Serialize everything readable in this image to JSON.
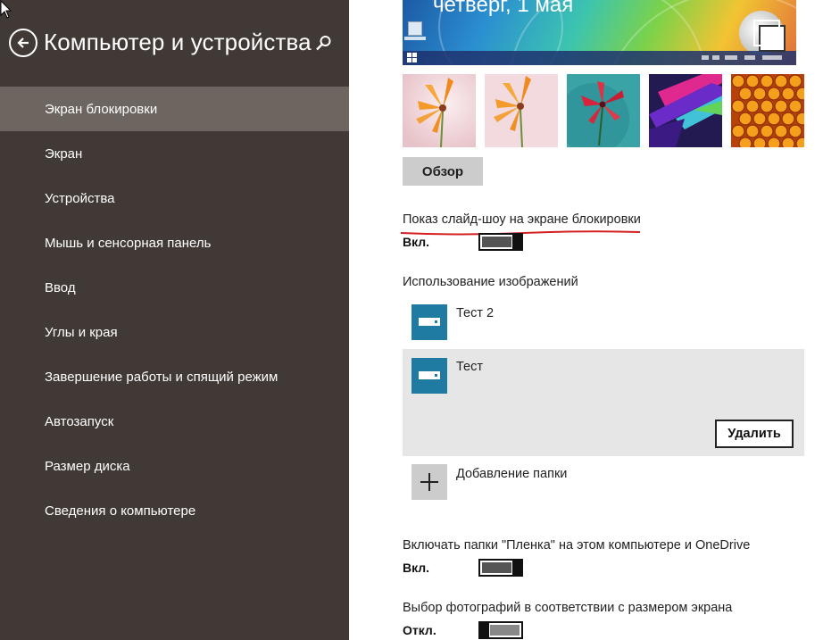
{
  "header": {
    "title": "Компьютер и устройства",
    "back_icon": "back-arrow-circle-icon",
    "search_icon": "search-icon"
  },
  "sidebar": {
    "items": [
      {
        "label": "Экран блокировки",
        "selected": true
      },
      {
        "label": "Экран"
      },
      {
        "label": "Устройства"
      },
      {
        "label": "Мышь и сенсорная панель"
      },
      {
        "label": "Ввод"
      },
      {
        "label": "Углы и края"
      },
      {
        "label": "Завершение работы и спящий режим"
      },
      {
        "label": "Автозапуск"
      },
      {
        "label": "Размер диска"
      },
      {
        "label": "Сведения о компьютере"
      }
    ]
  },
  "preview": {
    "date_text": "четверг, 1 мая"
  },
  "thumbnails": [
    "flower-pink",
    "flower-pink-2",
    "flower-red-teal",
    "geometric-ribbons",
    "honeycomb"
  ],
  "browse_label": "Обзор",
  "slideshow": {
    "label": "Показ слайд-шоу на экране блокировки",
    "state": "Вкл.",
    "on": true
  },
  "images_section": {
    "label": "Использование изображений",
    "folders": [
      {
        "name": "Тест 2",
        "selected": false
      },
      {
        "name": "Тест",
        "selected": true
      }
    ],
    "delete_label": "Удалить",
    "add_folder_label": "Добавление папки"
  },
  "camera_roll": {
    "label": "Включать папки \"Пленка\" на этом компьютере и OneDrive",
    "state": "Вкл.",
    "on": true
  },
  "fit_screen": {
    "label": "Выбор фотографий в соответствии с размером экрана",
    "state": "Откл.",
    "on": false
  },
  "colors": {
    "sidebar_bg": "#403936",
    "selected_item_bg": "#6c6560",
    "folder_tile": "#1f7ba1",
    "annotation_underline": "#d42020"
  }
}
